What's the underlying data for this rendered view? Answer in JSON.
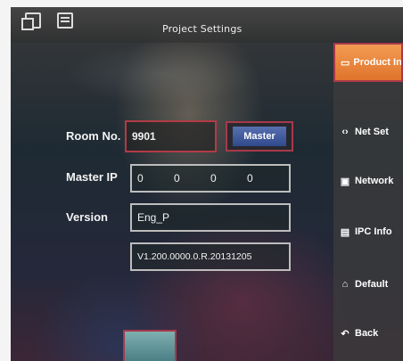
{
  "titlebar": {
    "title": "Project Settings"
  },
  "form": {
    "room_no_label": "Room No.",
    "room_no_value": "9901",
    "master_button": "Master",
    "master_ip_label": "Master IP",
    "master_ip_values": [
      "0",
      "0",
      "0",
      "0"
    ],
    "version_label": "Version",
    "version_value": "Eng_P",
    "firmware_value": "V1.200.0000.0.R.20131205"
  },
  "sidebar": {
    "items": [
      {
        "label": "Product Info",
        "icon": "product-info-icon",
        "glyph": "▭"
      },
      {
        "label": "Net Set",
        "icon": "net-set-icon",
        "glyph": "‹›"
      },
      {
        "label": "Network",
        "icon": "network-icon",
        "glyph": "▣"
      },
      {
        "label": "IPC Info",
        "icon": "ipc-info-icon",
        "glyph": "▤"
      },
      {
        "label": "Default",
        "icon": "default-icon",
        "glyph": "⌂"
      },
      {
        "label": "Back",
        "icon": "back-icon",
        "glyph": "↶"
      }
    ]
  },
  "colors": {
    "highlight": "#b23b46",
    "active_tab": "#f29b54",
    "master_button": "#3d5aa0"
  }
}
